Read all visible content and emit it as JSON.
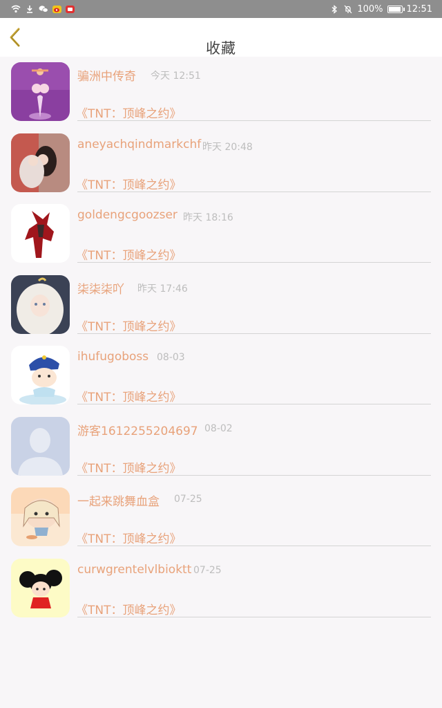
{
  "status_bar": {
    "battery": "100%",
    "clock": "12:51",
    "battery_level": 1.0,
    "left_icons": [
      "wifi-icon",
      "download-icon",
      "wechat-icon",
      "weibo-icon",
      "video-app-icon"
    ],
    "right_icons": [
      "bluetooth-icon",
      "mute-icon",
      "battery-icon"
    ]
  },
  "header": {
    "title": "收藏",
    "back_icon": "chevron-left-icon"
  },
  "colors": {
    "accent": "#e8a27a",
    "time": "#bdbdbd",
    "back_arrow": "#c9a636",
    "status_bar": "#8e8e8e"
  },
  "items": [
    {
      "user": "骗洲中传奇",
      "time": "今天 12:51",
      "title": "《TNT：顶峰之约》"
    },
    {
      "user": "aneyachqindmarkchf",
      "time": "昨天 20:48",
      "title": "《TNT：顶峰之约》"
    },
    {
      "user": "goldengcgoozser",
      "time": "昨天 18:16",
      "title": "《TNT：顶峰之约》"
    },
    {
      "user": "柒柒柒吖",
      "time": "昨天 17:46",
      "title": "《TNT：顶峰之约》"
    },
    {
      "user": "ihufugoboss",
      "time": "08-03",
      "title": "《TNT：顶峰之约》"
    },
    {
      "user": "游客1612255204697",
      "time": "08-02",
      "title": "《TNT：顶峰之约》"
    },
    {
      "user": "一起来跳舞血盒",
      "time": "07-25",
      "title": "《TNT：顶峰之约》"
    },
    {
      "user": "curwgrentelvlbioktt",
      "time": "07-25",
      "title": "《TNT：顶峰之约》"
    }
  ]
}
